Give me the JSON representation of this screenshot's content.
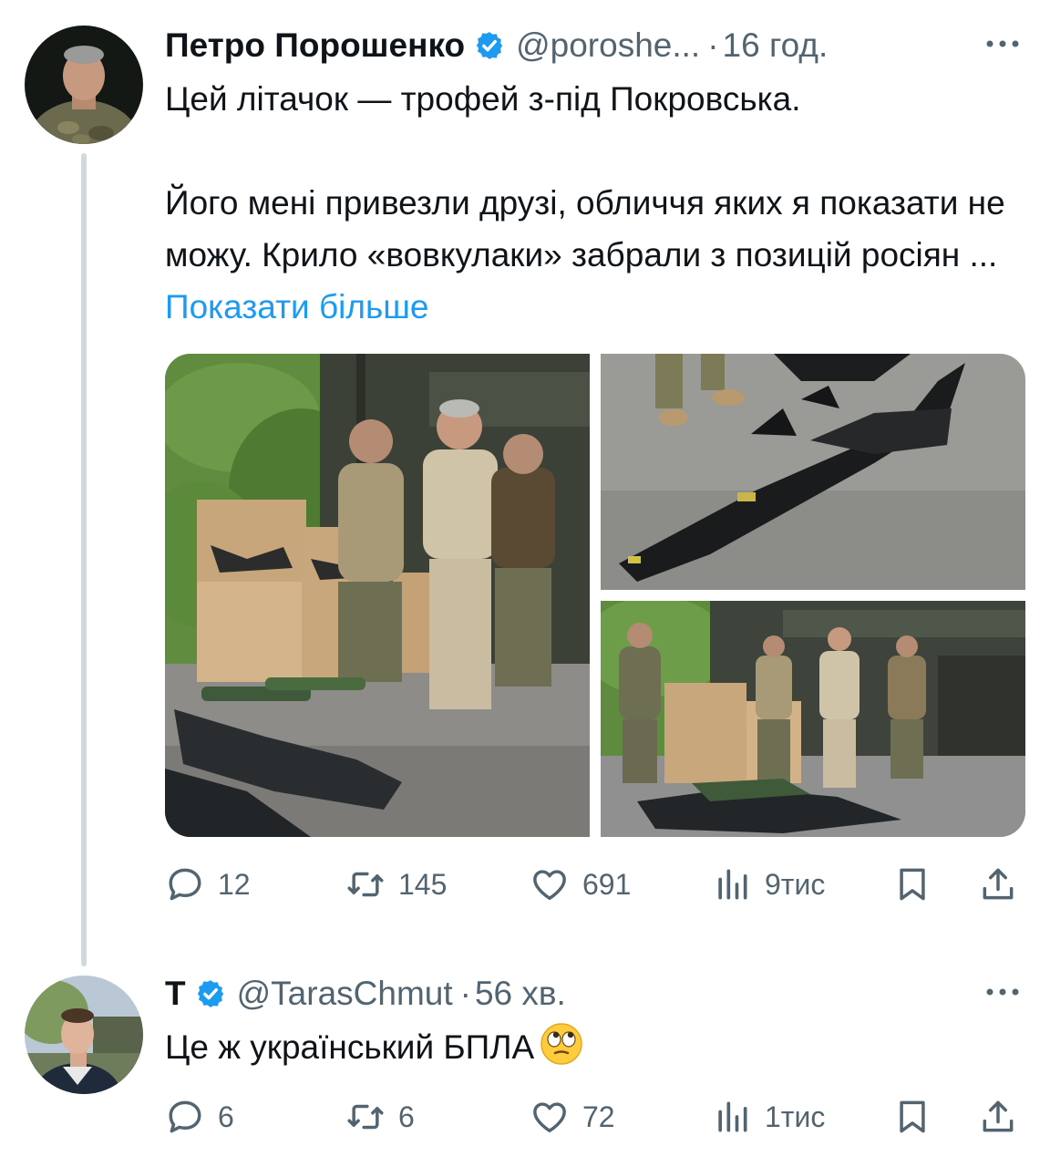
{
  "tweet": {
    "author": {
      "name": "Петро Порошенко",
      "handle": "@poroshe...",
      "separator": "·",
      "time": "16 год."
    },
    "text": {
      "line1": "Цей літачок — трофей з-під Покровська.",
      "para2": "Його мені привезли друзі, обличчя яких я показати не можу. Крило «вовкулаки» забрали з позицій росіян ...",
      "show_more": "Показати більше"
    },
    "stats": {
      "replies": "12",
      "retweets": "145",
      "likes": "691",
      "views": "9тис"
    }
  },
  "reply": {
    "author": {
      "name": "T",
      "handle": "@TarasChmut",
      "separator": "·",
      "time": "56 хв."
    },
    "text": "Це ж український БПЛА",
    "emoji": "face-with-rolling-eyes-icon",
    "stats": {
      "replies": "6",
      "retweets": "6",
      "likes": "72",
      "views": "1тис"
    }
  },
  "colors": {
    "text": "#0f1419",
    "secondary": "#536471",
    "accent": "#1d9bf0",
    "thread_line": "#cfd9de"
  }
}
